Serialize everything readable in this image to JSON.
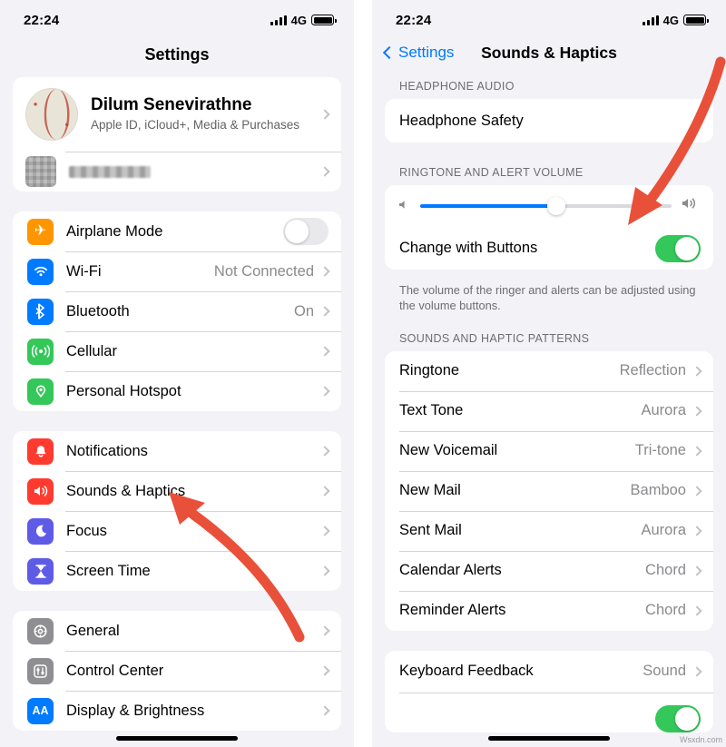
{
  "left": {
    "status": {
      "time": "22:24",
      "network": "4G"
    },
    "nav_title": "Settings",
    "account": {
      "name": "Dilum Senevirathne",
      "subtitle": "Apple ID, iCloud+, Media & Purchases"
    },
    "groups": [
      {
        "rows": [
          {
            "icon": "airplane-icon",
            "glyph": "✈",
            "color": "#ff9500",
            "label": "Airplane Mode",
            "value": "",
            "toggle": "off"
          },
          {
            "icon": "wifi-icon",
            "glyph": "◔",
            "color": "#007aff",
            "label": "Wi-Fi",
            "value": "Not Connected"
          },
          {
            "icon": "bluetooth-icon",
            "glyph": "ᛗ",
            "color": "#007aff",
            "label": "Bluetooth",
            "value": "On"
          },
          {
            "icon": "cellular-icon",
            "glyph": "((•))",
            "color": "#34c759",
            "label": "Cellular",
            "value": ""
          },
          {
            "icon": "hotspot-icon",
            "glyph": "⚭",
            "color": "#34c759",
            "label": "Personal Hotspot",
            "value": ""
          }
        ]
      },
      {
        "rows": [
          {
            "icon": "notifications-icon",
            "glyph": "▣",
            "color": "#ff3b30",
            "label": "Notifications",
            "value": ""
          },
          {
            "icon": "sounds-haptics-icon",
            "glyph": "🔊",
            "color": "#ff3b30",
            "label": "Sounds & Haptics",
            "value": ""
          },
          {
            "icon": "focus-icon",
            "glyph": "☽",
            "color": "#5e5ce6",
            "label": "Focus",
            "value": ""
          },
          {
            "icon": "screen-time-icon",
            "glyph": "⧗",
            "color": "#5e5ce6",
            "label": "Screen Time",
            "value": ""
          }
        ]
      },
      {
        "rows": [
          {
            "icon": "general-icon",
            "glyph": "⚙",
            "color": "#8e8e93",
            "label": "General",
            "value": ""
          },
          {
            "icon": "control-center-icon",
            "glyph": "⊞",
            "color": "#8e8e93",
            "label": "Control Center",
            "value": ""
          },
          {
            "icon": "display-brightness-icon",
            "glyph": "AA",
            "color": "#007aff",
            "label": "Display & Brightness",
            "value": ""
          }
        ]
      }
    ]
  },
  "right": {
    "status": {
      "time": "22:24",
      "network": "4G"
    },
    "back_label": "Settings",
    "nav_title": "Sounds & Haptics",
    "headphone_section": "HEADPHONE AUDIO",
    "headphone_row": {
      "label": "Headphone Safety",
      "value": ""
    },
    "ringtone_section": "RINGTONE AND ALERT VOLUME",
    "volume": {
      "level": 54,
      "low_icon": "speaker-low-icon",
      "high_icon": "speaker-high-icon"
    },
    "change_with_buttons": {
      "label": "Change with Buttons",
      "state": "on"
    },
    "volume_footnote": "The volume of the ringer and alerts can be adjusted using the volume buttons.",
    "patterns_section": "SOUNDS AND HAPTIC PATTERNS",
    "patterns": [
      {
        "label": "Ringtone",
        "value": "Reflection"
      },
      {
        "label": "Text Tone",
        "value": "Aurora"
      },
      {
        "label": "New Voicemail",
        "value": "Tri-tone"
      },
      {
        "label": "New Mail",
        "value": "Bamboo"
      },
      {
        "label": "Sent Mail",
        "value": "Aurora"
      },
      {
        "label": "Calendar Alerts",
        "value": "Chord"
      },
      {
        "label": "Reminder Alerts",
        "value": "Chord"
      }
    ],
    "keyboard_row": {
      "label": "Keyboard Feedback",
      "value": "Sound"
    }
  },
  "watermark": "Wsxdn.com",
  "colors": {
    "accent": "#007aff",
    "toggle_on": "#34c759",
    "arrow": "#e8503a",
    "group_bg": "#ffffff",
    "page_bg": "#f2f2f7"
  }
}
